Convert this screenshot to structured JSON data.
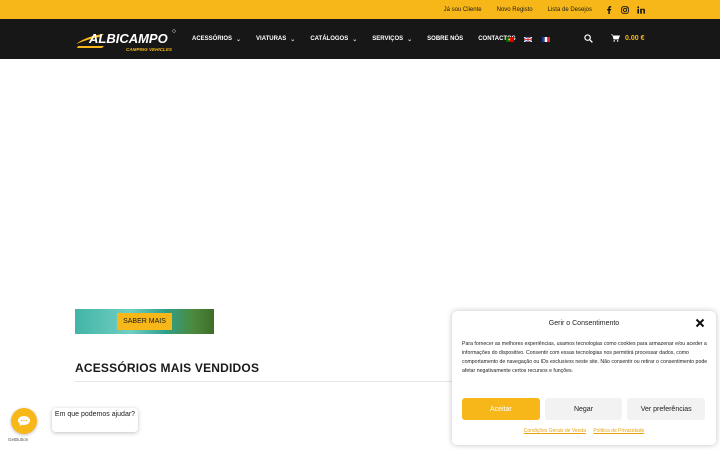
{
  "topbar": {
    "links": [
      "Já sou Cliente",
      "Novo Registo",
      "Lista de Desejos"
    ],
    "social_icons": [
      "facebook-icon",
      "instagram-icon",
      "linkedin-icon"
    ]
  },
  "brand": {
    "name": "ALBICAMPO",
    "tagline": "CAMPING VEHICLES",
    "accent": "#f7b718"
  },
  "menu": [
    {
      "label": "Acessórios",
      "has_dropdown": true
    },
    {
      "label": "Viaturas",
      "has_dropdown": true
    },
    {
      "label": "Catálogos",
      "has_dropdown": true
    },
    {
      "label": "Serviços",
      "has_dropdown": true
    },
    {
      "label": "Sobre Nós",
      "has_dropdown": false
    },
    {
      "label": "Contactos",
      "has_dropdown": false
    }
  ],
  "languages": [
    "pt",
    "en",
    "fr"
  ],
  "cart": {
    "total": "0.00 €"
  },
  "banner": {
    "button_label": "SABER MAIS"
  },
  "section": {
    "title": "ACESSÓRIOS MAIS VENDIDOS"
  },
  "chat": {
    "bubble_text": "Em que podemos ajudar?",
    "credit": "GetButton"
  },
  "consent": {
    "title": "Gerir o Consentimento",
    "body": "Para fornecer as melhores experiências, usamos tecnologias como cookies para armazenar e/ou aceder a informações do dispositivo. Consentir com essas tecnologias nos permitirá processar dados, como comportamento de navegação ou IDs exclusivos neste site. Não consentir ou retirar o consentimento pode afetar negativamente certos recursos e funções.",
    "accept": "Aceitar",
    "deny": "Negar",
    "preferences": "Ver preferências",
    "links": [
      "Condições Gerais de Venda",
      "Política de Privacidade"
    ]
  }
}
